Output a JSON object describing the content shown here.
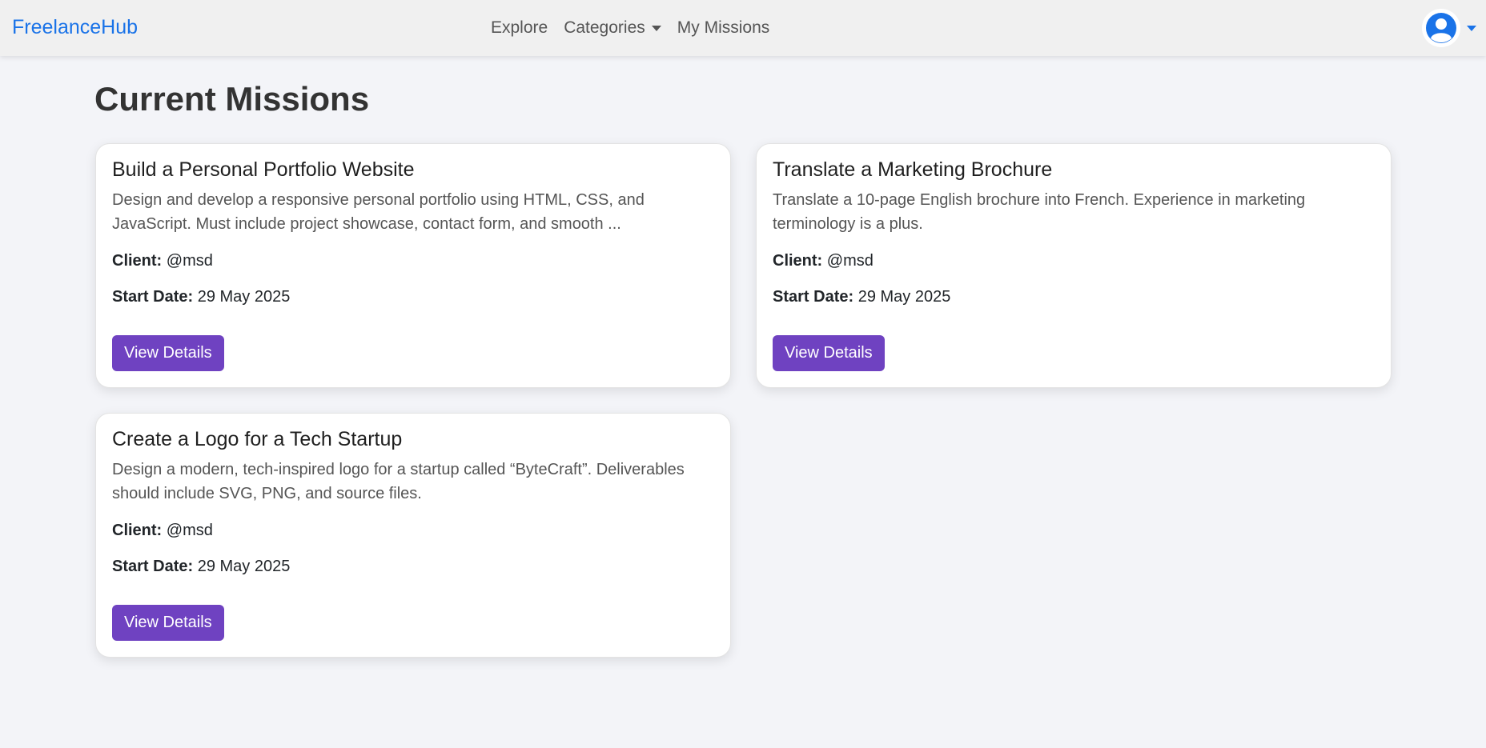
{
  "navbar": {
    "brand": "FreelanceHub",
    "links": [
      {
        "label": "Explore"
      },
      {
        "label": "Categories"
      },
      {
        "label": "My Missions"
      }
    ],
    "colors": {
      "brand": "#1a73e8",
      "background": "#f0f0f0"
    },
    "user_icon": "user-avatar-icon"
  },
  "main": {
    "title": "Current Missions",
    "missions": [
      {
        "title": "Build a Personal Portfolio Website",
        "description": "Design and develop a responsive personal portfolio using HTML, CSS, and JavaScript. Must include project showcase, contact form, and smooth ...",
        "client_label": "Client:",
        "client": "@msd",
        "start_label": "Start Date:",
        "start_date": "29 May 2025",
        "button": "View Details"
      },
      {
        "title": "Translate a Marketing Brochure",
        "description": "Translate a 10-page English brochure into French. Experience in marketing terminology is a plus.",
        "client_label": "Client:",
        "client": "@msd",
        "start_label": "Start Date:",
        "start_date": "29 May 2025",
        "button": "View Details"
      },
      {
        "title": "Create a Logo for a Tech Startup",
        "description": "Design a modern, tech-inspired logo for a startup called “ByteCraft”. Deliverables should include SVG, PNG, and source files.",
        "client_label": "Client:",
        "client": "@msd",
        "start_label": "Start Date:",
        "start_date": "29 May 2025",
        "button": "View Details"
      }
    ],
    "colors": {
      "button": "#6f42c1",
      "page_background": "#f3f4f8"
    }
  }
}
